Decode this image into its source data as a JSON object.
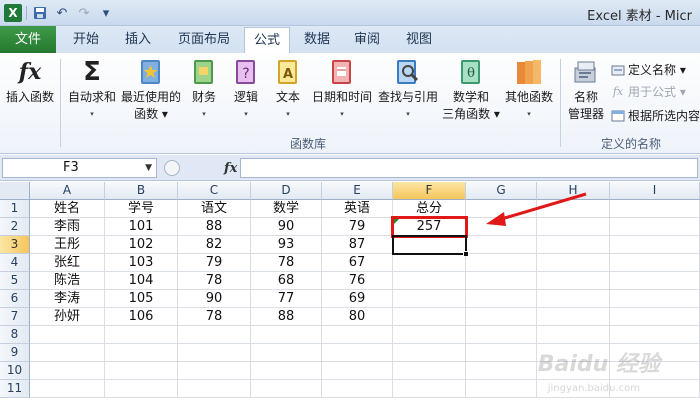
{
  "window": {
    "title": "Excel 素材 - Micr",
    "app_badge": "X"
  },
  "qat": {
    "undo": "↶",
    "redo": "↷",
    "customize": "▾"
  },
  "tabs": {
    "file": "文件",
    "items": [
      "开始",
      "插入",
      "页面布局",
      "公式",
      "数据",
      "审阅",
      "视图"
    ],
    "active": "公式"
  },
  "ribbon": {
    "function_library": {
      "label": "函数库",
      "buttons": [
        {
          "label": "插入函数",
          "sub": "",
          "icon": "fx-icon"
        },
        {
          "label": "自动求和",
          "sub": "▾",
          "icon": "sigma-icon"
        },
        {
          "label": "最近使用的",
          "sub": "函数 ▾",
          "icon": "star-book-icon"
        },
        {
          "label": "财务",
          "sub": "▾",
          "icon": "finance-book-icon"
        },
        {
          "label": "逻辑",
          "sub": "▾",
          "icon": "logic-book-icon"
        },
        {
          "label": "文本",
          "sub": "▾",
          "icon": "text-book-icon"
        },
        {
          "label": "日期和时间",
          "sub": "▾",
          "icon": "datetime-book-icon"
        },
        {
          "label": "查找与引用",
          "sub": "▾",
          "icon": "lookup-book-icon"
        },
        {
          "label": "数学和",
          "sub": "三角函数 ▾",
          "icon": "math-book-icon"
        },
        {
          "label": "其他函数",
          "sub": "▾",
          "icon": "more-functions-icon"
        }
      ]
    },
    "defined_names": {
      "label": "定义的名称",
      "manager": {
        "label": "名称",
        "sub": "管理器"
      },
      "define_name": "定义名称 ▾",
      "use_in_formula": "用于公式 ▾",
      "create_from_selection": "根据所选内容"
    }
  },
  "formula_bar": {
    "name_box": "F3",
    "fx": "fx",
    "value": ""
  },
  "sheet": {
    "columns": [
      "A",
      "B",
      "C",
      "D",
      "E",
      "F",
      "G",
      "H",
      "I"
    ],
    "selected_column": "F",
    "rows": [
      "1",
      "2",
      "3",
      "4",
      "5",
      "6",
      "7",
      "8",
      "9",
      "10",
      "11"
    ],
    "selected_row": "3",
    "cells": [
      [
        "姓名",
        "学号",
        "语文",
        "数学",
        "英语",
        "总分"
      ],
      [
        "李雨",
        "101",
        "88",
        "90",
        "79",
        "257"
      ],
      [
        "王彤",
        "102",
        "82",
        "93",
        "87",
        ""
      ],
      [
        "张红",
        "103",
        "79",
        "78",
        "67",
        ""
      ],
      [
        "陈浩",
        "104",
        "78",
        "68",
        "76",
        ""
      ],
      [
        "李涛",
        "105",
        "90",
        "77",
        "69",
        ""
      ],
      [
        "孙妍",
        "106",
        "78",
        "88",
        "80",
        ""
      ]
    ]
  },
  "annotation": {
    "highlight_color": "#e01818"
  },
  "watermark": {
    "logo": "Baidu 经验",
    "sub": "jingyan.baidu.com"
  },
  "colors": {
    "file_tab": "#2a7f34",
    "selected_header": "#f5c65d"
  }
}
